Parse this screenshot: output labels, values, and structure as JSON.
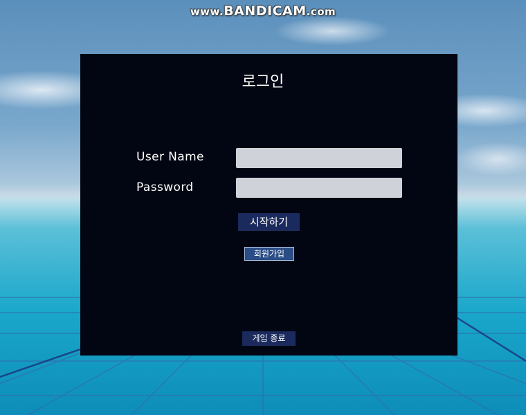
{
  "watermark": {
    "prefix": "www.",
    "brand": "BANDICAM",
    "suffix": ".com"
  },
  "login": {
    "title": "로그인",
    "username_label": "User Name",
    "username_value": "",
    "password_label": "Password",
    "password_value": "",
    "start_button": "시작하기",
    "signup_button": "회원가입",
    "exit_button": "게임 종료"
  },
  "colors": {
    "panel_background": "#020612",
    "button_background": "#1b2a5c",
    "input_background": "#cfd2d8"
  }
}
